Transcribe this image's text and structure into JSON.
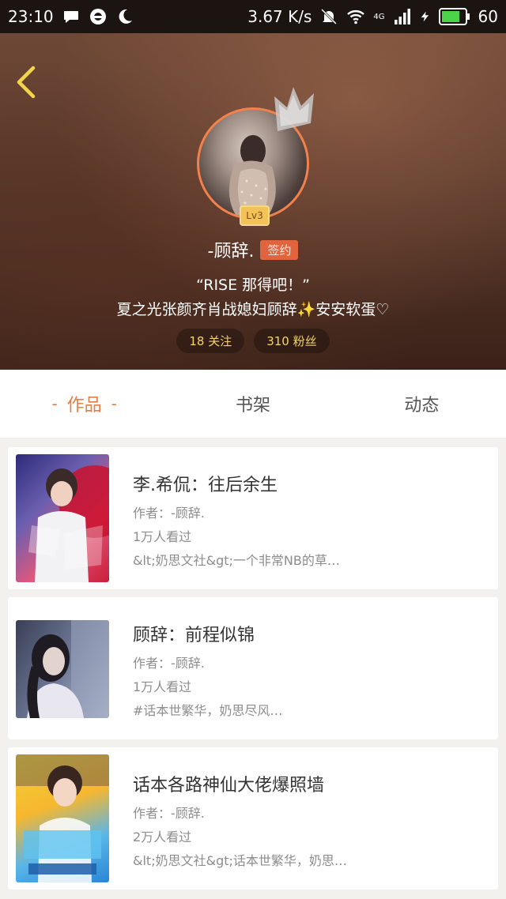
{
  "status_bar": {
    "time": "23:10",
    "speed": "3.67 K/s",
    "network": "4G",
    "battery": "60",
    "icons": [
      "chat-bubble-icon",
      "shield-circle-icon",
      "moon-icon",
      "mute-bell-icon",
      "wifi-icon",
      "signal-icon",
      "charging-icon",
      "battery-icon"
    ]
  },
  "profile": {
    "level": "Lv3",
    "name": "-顾辞.",
    "sign_badge": "签约",
    "bio_line1": "“RISE 那得吧！”",
    "bio_line2": "夏之光张颜齐肖战媳妇顾辞✨安安软蛋♡",
    "following": "18 关注",
    "fans": "310 粉丝"
  },
  "tabs": [
    {
      "label": "作品",
      "active": true
    },
    {
      "label": "书架",
      "active": false
    },
    {
      "label": "动态",
      "active": false
    }
  ],
  "books": [
    {
      "title": "李.希侃：往后余生",
      "author": "作者：-顾辞.",
      "views": "1万人看过",
      "desc": "&lt;奶思文社&gt;一个非常NB的草…"
    },
    {
      "title": "顾辞：前程似锦",
      "author": "作者：-顾辞.",
      "views": "1万人看过",
      "desc": "#话本世繁华，奶思尽风…"
    },
    {
      "title": "话本各路神仙大佬爆照墙",
      "author": "作者：-顾辞.",
      "views": "2万人看过",
      "desc": "&lt;奶思文社&gt;话本世繁华，奶思…"
    }
  ],
  "colors": {
    "accent": "#e57e45",
    "sign_badge": "#e0643e",
    "stat_text": "#f4d46a",
    "back_arrow": "#f2d54b"
  }
}
